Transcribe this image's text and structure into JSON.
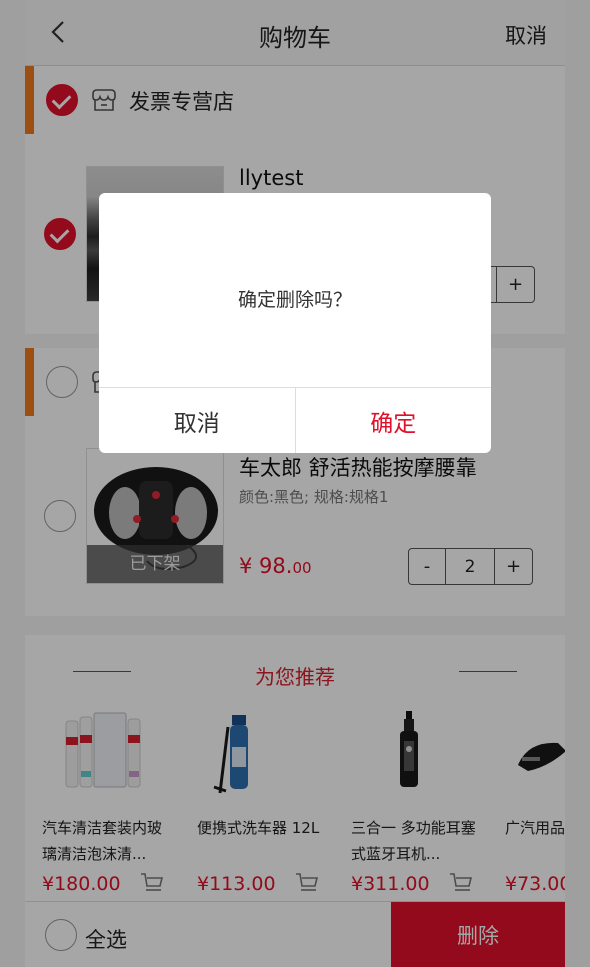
{
  "header": {
    "title": "购物车",
    "cancel_label": "取消"
  },
  "stores": [
    {
      "name": "发票专营店",
      "checked": true,
      "items": [
        {
          "name": "llytest",
          "checked": true
        }
      ]
    },
    {
      "name": "",
      "checked": false,
      "items": [
        {
          "name": "车太郎 舒活热能按摩腰靠",
          "spec": "颜色:黑色;   规格:规格1",
          "price_main": "¥ 98.",
          "price_cents": "00",
          "quantity": "2",
          "status": "已下架",
          "checked": false
        }
      ]
    }
  ],
  "stepper": {
    "minus": "-",
    "plus": "+"
  },
  "recommend": {
    "title": "为您推荐",
    "products": [
      {
        "name": "汽车清洁套装内玻璃清洁泡沫清...",
        "price": "¥180.00"
      },
      {
        "name": "便携式洗车器 12L",
        "price": "¥113.00"
      },
      {
        "name": "三合一 多功能耳塞式蓝牙耳机...",
        "price": "¥311.00"
      },
      {
        "name": "广汽用品功能安全",
        "price": "¥73.00"
      }
    ]
  },
  "footer": {
    "select_all": "全选",
    "delete": "删除"
  },
  "dialog": {
    "message": "确定删除吗？",
    "cancel": "取消",
    "confirm": "确定"
  },
  "colors": {
    "accent": "#e0102a",
    "store_bar": "#f07a1a"
  }
}
